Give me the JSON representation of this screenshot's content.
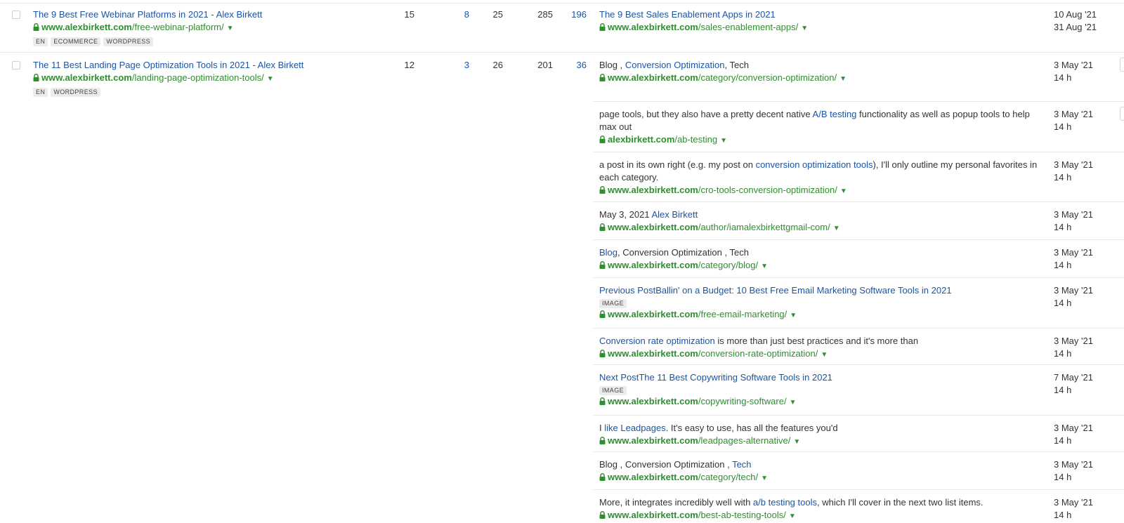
{
  "rows": [
    {
      "title": "The 9 Best Free Webinar Platforms in 2021 - Alex Birkett",
      "url_domain": "www.alexbirkett.com",
      "url_path": "/free-webinar-platform/",
      "tags": [
        "EN",
        "ECOMMERCE",
        "WORDPRESS"
      ],
      "metrics": [
        "15",
        "8",
        "25",
        "285",
        "196"
      ],
      "anchor_title": "The 9 Best Sales Enablement Apps in 2021",
      "anchor_domain": "www.alexbirkett.com",
      "anchor_path": "/sales-enablement-apps/",
      "date1": "10 Aug '21",
      "date2": "31 Aug '21"
    },
    {
      "title": "The 11 Best Landing Page Optimization Tools in 2021 - Alex Birkett",
      "url_domain": "www.alexbirkett.com",
      "url_path": "/landing-page-optimization-tools/",
      "tags": [
        "EN",
        "WORDPRESS"
      ],
      "metrics": [
        "12",
        "3",
        "26",
        "201",
        "36"
      ]
    }
  ],
  "links": [
    {
      "parts": [
        {
          "t": "Blog , "
        },
        {
          "t": "Conversion Optimization",
          "l": true
        },
        {
          "t": ", Tech"
        }
      ],
      "domain": "www.alexbirkett.com",
      "path": "/category/conversion-optimization/",
      "date": "3 May '21",
      "time": "14 h"
    },
    {
      "parts": [
        {
          "t": "page tools, but they also have a pretty decent native "
        },
        {
          "t": "A/B testing",
          "l": true
        },
        {
          "t": " functionality as well as popup tools to help max out"
        }
      ],
      "domain": "alexbirkett.com",
      "path": "/ab-testing",
      "date": "3 May '21",
      "time": "14 h"
    },
    {
      "parts": [
        {
          "t": "a post in its own right (e.g. my post on "
        },
        {
          "t": "conversion optimization tools",
          "l": true
        },
        {
          "t": "), I'll only outline my personal fa­vorites in each category."
        }
      ],
      "domain": "www.alexbirkett.com",
      "path": "/cro-tools-conversion-optimization/",
      "date": "3 May '21",
      "time": "14 h"
    },
    {
      "parts": [
        {
          "t": "May 3, 2021 "
        },
        {
          "t": "Alex Birkett",
          "l": true
        }
      ],
      "domain": "www.alexbirkett.com",
      "path": "/author/iamalexbirkettgmail-com/",
      "date": "3 May '21",
      "time": "14 h"
    },
    {
      "parts": [
        {
          "t": "Blog",
          "l": true
        },
        {
          "t": ", Conversion Optimization , Tech"
        }
      ],
      "domain": "www.alexbirkett.com",
      "path": "/category/blog/",
      "date": "3 May '21",
      "time": "14 h"
    },
    {
      "parts": [
        {
          "t": "Previous PostBallin' on a Budget: 10 Best Free Email Marketing Software Tools in 2021",
          "l": true
        }
      ],
      "tag": "IMAGE",
      "domain": "www.alexbirkett.com",
      "path": "/free-email-marketing/",
      "date": "3 May '21",
      "time": "14 h"
    },
    {
      "parts": [
        {
          "t": "Conversion rate optimization",
          "l": true
        },
        {
          "t": " is more than just best practices and it's more than"
        }
      ],
      "domain": "www.alexbirkett.com",
      "path": "/conversion-rate-optimization/",
      "date": "3 May '21",
      "time": "14 h"
    },
    {
      "parts": [
        {
          "t": "Next PostThe 11 Best Copywriting Software Tools in 2021",
          "l": true
        }
      ],
      "tag": "IMAGE",
      "domain": "www.alexbirkett.com",
      "path": "/copywriting-software/",
      "date": "7 May '21",
      "time": "14 h"
    },
    {
      "parts": [
        {
          "t": "I "
        },
        {
          "t": "like Leadpages",
          "l": true
        },
        {
          "t": ". It's easy to use, has all the features you'd"
        }
      ],
      "domain": "www.alexbirkett.com",
      "path": "/leadpages-alternative/",
      "date": "3 May '21",
      "time": "14 h"
    },
    {
      "parts": [
        {
          "t": "Blog , Conversion Optimization , "
        },
        {
          "t": "Tech",
          "l": true
        }
      ],
      "domain": "www.alexbirkett.com",
      "path": "/category/tech/",
      "date": "3 May '21",
      "time": "14 h"
    },
    {
      "parts": [
        {
          "t": "More, it integrates incredibly well with "
        },
        {
          "t": "a/b testing tools",
          "l": true
        },
        {
          "t": ", which I'll cover in the next two list items."
        }
      ],
      "domain": "www.alexbirkett.com",
      "path": "/best-ab-testing-tools/",
      "date": "3 May '21",
      "time": "14 h"
    }
  ],
  "colors": {
    "link": "#1a55a8",
    "url": "#2f8e2f",
    "divider": "#e6e6e6",
    "tag_bg": "#ececec"
  },
  "icons": [
    "lock-icon",
    "dropdown-caret-icon",
    "checkbox"
  ]
}
